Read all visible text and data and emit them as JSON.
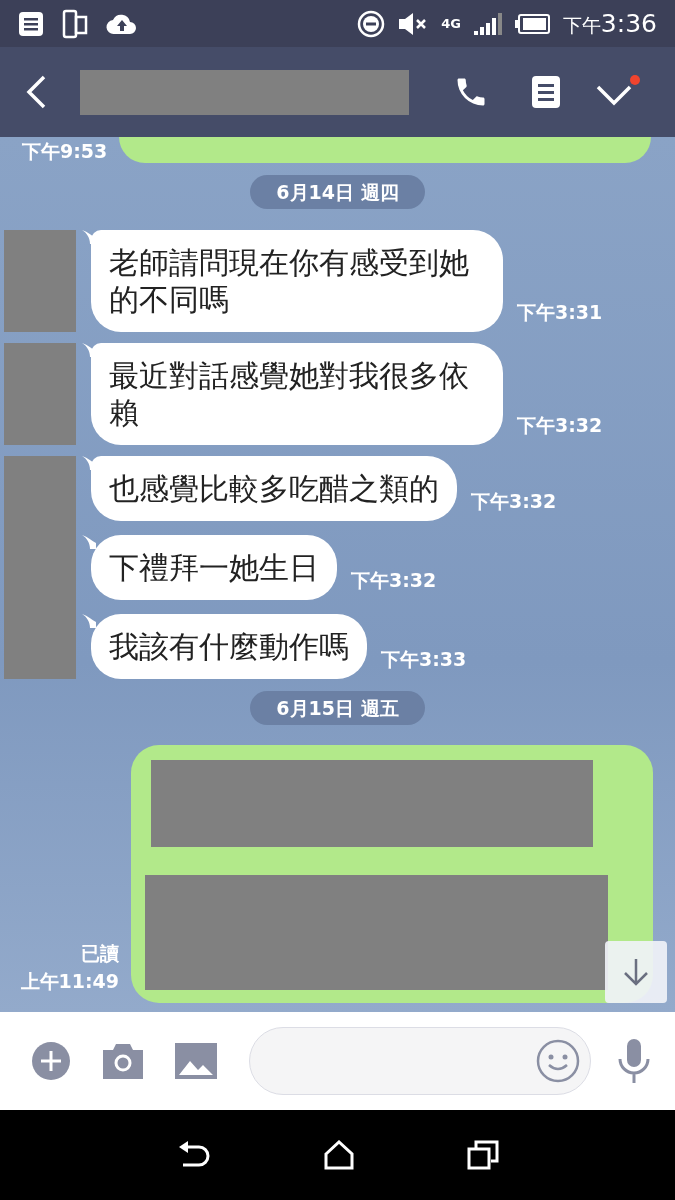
{
  "status_bar": {
    "time_period": "下午",
    "time": "3:36",
    "network": "4G"
  },
  "header": {
    "menu_badge": true
  },
  "thread": [
    {
      "kind": "outgoing_partial",
      "time": "下午9:53"
    },
    {
      "kind": "date",
      "label": "6月14日 週四"
    },
    {
      "kind": "incoming",
      "messages": [
        {
          "text": "老師請問現在你有感受到她的不同嗎",
          "time": "下午3:31"
        }
      ]
    },
    {
      "kind": "incoming",
      "messages": [
        {
          "text": "最近對話感覺她對我很多依賴",
          "time": "下午3:32"
        }
      ]
    },
    {
      "kind": "incoming",
      "messages": [
        {
          "text": "也感覺比較多吃醋之類的",
          "time": "下午3:32"
        },
        {
          "text": "下禮拜一她生日",
          "time": "下午3:32"
        },
        {
          "text": "我該有什麼動作嗎",
          "time": "下午3:33"
        }
      ]
    },
    {
      "kind": "date",
      "label": "6月15日 週五"
    },
    {
      "kind": "outgoing",
      "read_label": "已讀",
      "time": "上午11:49"
    }
  ]
}
